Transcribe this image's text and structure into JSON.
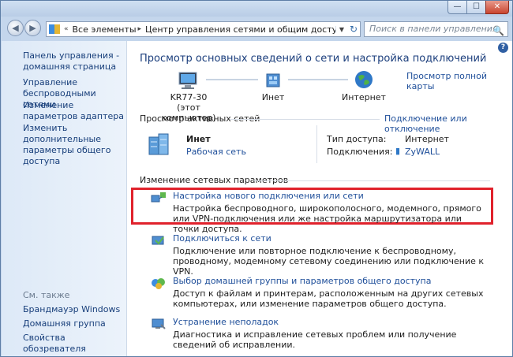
{
  "titlebar": {
    "min": "—",
    "max": "☐",
    "close": "✕"
  },
  "address": {
    "crumb1": "Все элементы пане...",
    "crumb2": "Центр управления сетями и общим доступом"
  },
  "search": {
    "placeholder": "Поиск в панели управления"
  },
  "sidebar": {
    "items": [
      "Панель управления - домашняя страница",
      "Управление беспроводными сетями",
      "Изменение параметров адаптера",
      "Изменить дополнительные параметры общего доступа"
    ],
    "see_also_title": "См. также",
    "see_also": [
      "Брандмауэр Windows",
      "Домашняя группа",
      "Свойства обозревателя"
    ]
  },
  "main": {
    "title": "Просмотр основных сведений о сети и настройка подключений",
    "full_map_link": "Просмотр полной карты",
    "map": {
      "computer_name": "KR77-30",
      "computer_sub": "(этот компьютер)",
      "network": "Инет",
      "internet": "Интернет"
    },
    "active_title": "Просмотр активных сетей",
    "connect_disconnect": "Подключение или отключение",
    "active_network": {
      "name": "Инет",
      "type": "Рабочая сеть",
      "access_label": "Тип доступа:",
      "access_value": "Интернет",
      "connections_label": "Подключения:",
      "connections_value": "ZyWALL"
    },
    "change_title": "Изменение сетевых параметров",
    "tasks": [
      {
        "title": "Настройка нового подключения или сети",
        "desc": "Настройка беспроводного, широкополосного, модемного, прямого или VPN-подключения или же настройка маршрутизатора или точки доступа."
      },
      {
        "title": "Подключиться к сети",
        "desc": "Подключение или повторное подключение к беспроводному, проводному, модемному сетевому соединению или подключение к VPN."
      },
      {
        "title": "Выбор домашней группы и параметров общего доступа",
        "desc": "Доступ к файлам и принтерам, расположенным на других сетевых компьютерах, или изменение параметров общего доступа."
      },
      {
        "title": "Устранение неполадок",
        "desc": "Диагностика и исправление сетевых проблем или получение сведений об исправлении."
      }
    ]
  }
}
